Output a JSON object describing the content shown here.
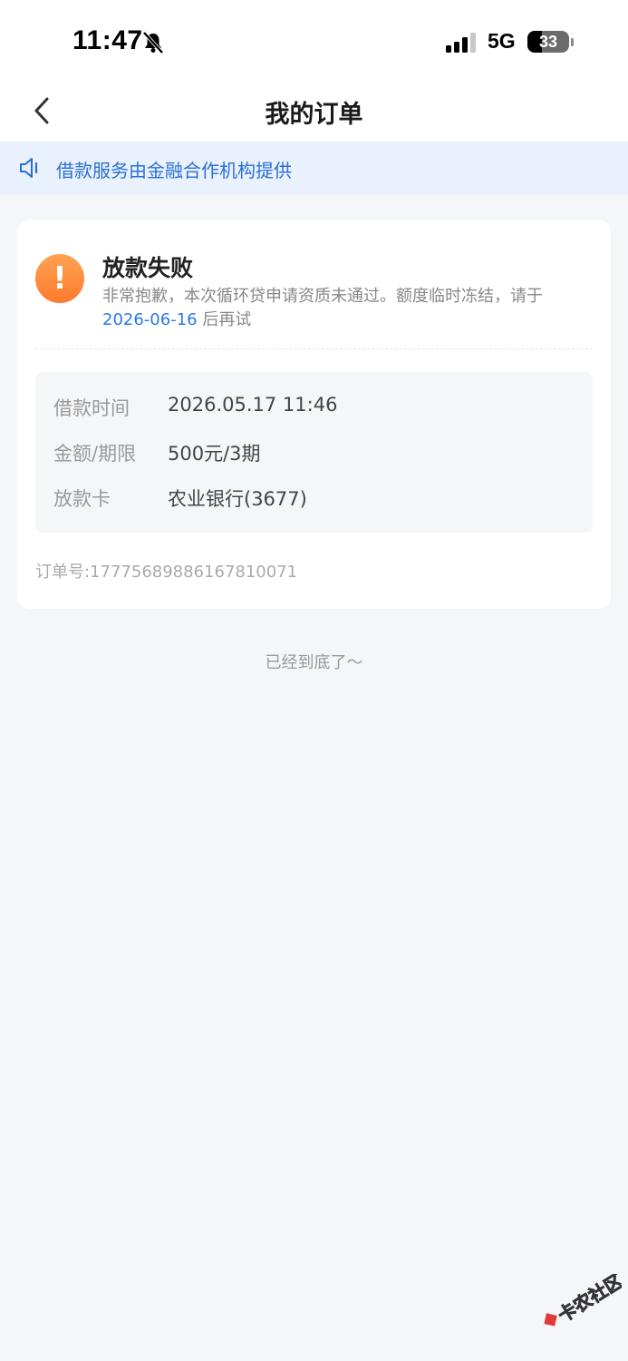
{
  "status_bar": {
    "time": "11:47",
    "network": "5G",
    "battery": "33"
  },
  "nav": {
    "title": "我的订单"
  },
  "notice": {
    "text": "借款服务由金融合作机构提供"
  },
  "order": {
    "status_title": "放款失败",
    "status_desc": "非常抱歉，本次循环贷申请资质未通过。额度临时冻结，请于",
    "retry_date": "2026-06-16",
    "retry_suffix": " 后再试",
    "rows": [
      {
        "label": "借款时间",
        "value": "2026.05.17 11:46"
      },
      {
        "label": "金额/期限",
        "value": "500元/3期"
      },
      {
        "label": "放款卡",
        "value": "农业银行(3677)"
      }
    ],
    "order_no": "订单号:17775689886167810071"
  },
  "footer": {
    "end_text": "已经到底了～"
  },
  "watermark": {
    "text": "卡农社区"
  },
  "colors": {
    "accent": "#2b78e4",
    "warning": "#ff8a3d",
    "background": "#f5f6f9"
  },
  "icons": {
    "back": "chevron-left-icon",
    "notice": "speaker-icon",
    "status": "warning-icon",
    "mute": "bell-slash-icon"
  }
}
